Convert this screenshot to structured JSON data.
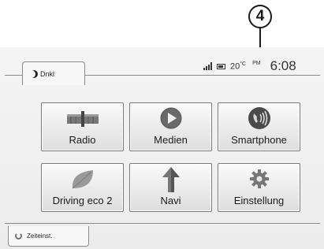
{
  "callout": {
    "number": "4"
  },
  "status": {
    "night_mode_label": "Dnkl",
    "temperature": "20",
    "temperature_unit": "°C",
    "ampm": "PM",
    "time": "6:08"
  },
  "tiles": [
    {
      "label": "Radio",
      "icon": "radio-icon"
    },
    {
      "label": "Medien",
      "icon": "media-play-icon"
    },
    {
      "label": "Smartphone",
      "icon": "smartphone-icon"
    },
    {
      "label": "Driving eco 2",
      "icon": "eco-leaf-icon"
    },
    {
      "label": "Navi",
      "icon": "navigation-arrow-icon"
    },
    {
      "label": "Einstellung",
      "icon": "settings-gear-icon"
    }
  ],
  "footer": {
    "time_setting_label": "Zeiteinst."
  }
}
